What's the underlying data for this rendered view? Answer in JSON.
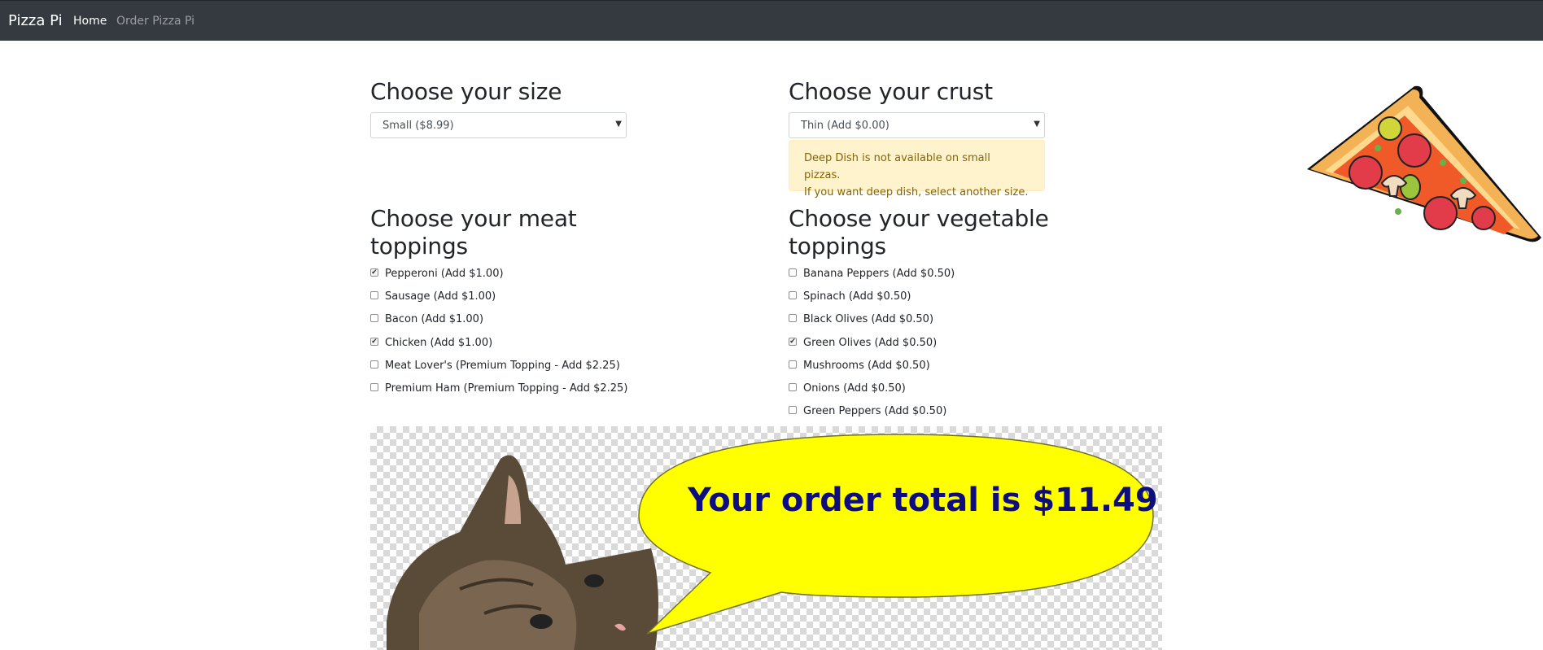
{
  "nav": {
    "brand": "Pizza Pi",
    "links": [
      {
        "label": "Home",
        "active": true
      },
      {
        "label": "Order Pizza Pi",
        "active": false
      }
    ]
  },
  "size": {
    "title": "Choose your size",
    "selected": "Small ($8.99)"
  },
  "crust": {
    "title": "Choose your crust",
    "selected": "Thin (Add $0.00)",
    "alert_line1": "Deep Dish is not available on small pizzas.",
    "alert_line2": "If you want deep dish, select another size."
  },
  "meat": {
    "title_line1": "Choose your meat",
    "title_line2": "toppings",
    "items": [
      {
        "label": "Pepperoni (Add $1.00)",
        "checked": true
      },
      {
        "label": "Sausage (Add $1.00)",
        "checked": false
      },
      {
        "label": "Bacon (Add $1.00)",
        "checked": false
      },
      {
        "label": "Chicken (Add $1.00)",
        "checked": true
      },
      {
        "label": "Meat Lover's (Premium Topping - Add $2.25)",
        "checked": false
      },
      {
        "label": "Premium Ham (Premium Topping - Add $2.25)",
        "checked": false
      }
    ]
  },
  "veg": {
    "title_line1": "Choose your vegetable",
    "title_line2": "toppings",
    "items": [
      {
        "label": "Banana Peppers (Add $0.50)",
        "checked": false
      },
      {
        "label": "Spinach (Add $0.50)",
        "checked": false
      },
      {
        "label": "Black Olives (Add $0.50)",
        "checked": false
      },
      {
        "label": "Green Olives (Add $0.50)",
        "checked": true
      },
      {
        "label": "Mushrooms (Add $0.50)",
        "checked": false
      },
      {
        "label": "Onions (Add $0.50)",
        "checked": false
      },
      {
        "label": "Green Peppers (Add $0.50)",
        "checked": false
      }
    ]
  },
  "order": {
    "total_text": "Your order total is $11.49"
  },
  "colors": {
    "navbar": "#343a40",
    "bubble": "#ffff00",
    "total_text": "#0d0d80",
    "alert_bg": "#fff3cd"
  },
  "icons": {
    "select_arrow": "chevron-down-icon",
    "pizza": "pizza-slice-illustration",
    "cat": "cat-photo"
  }
}
